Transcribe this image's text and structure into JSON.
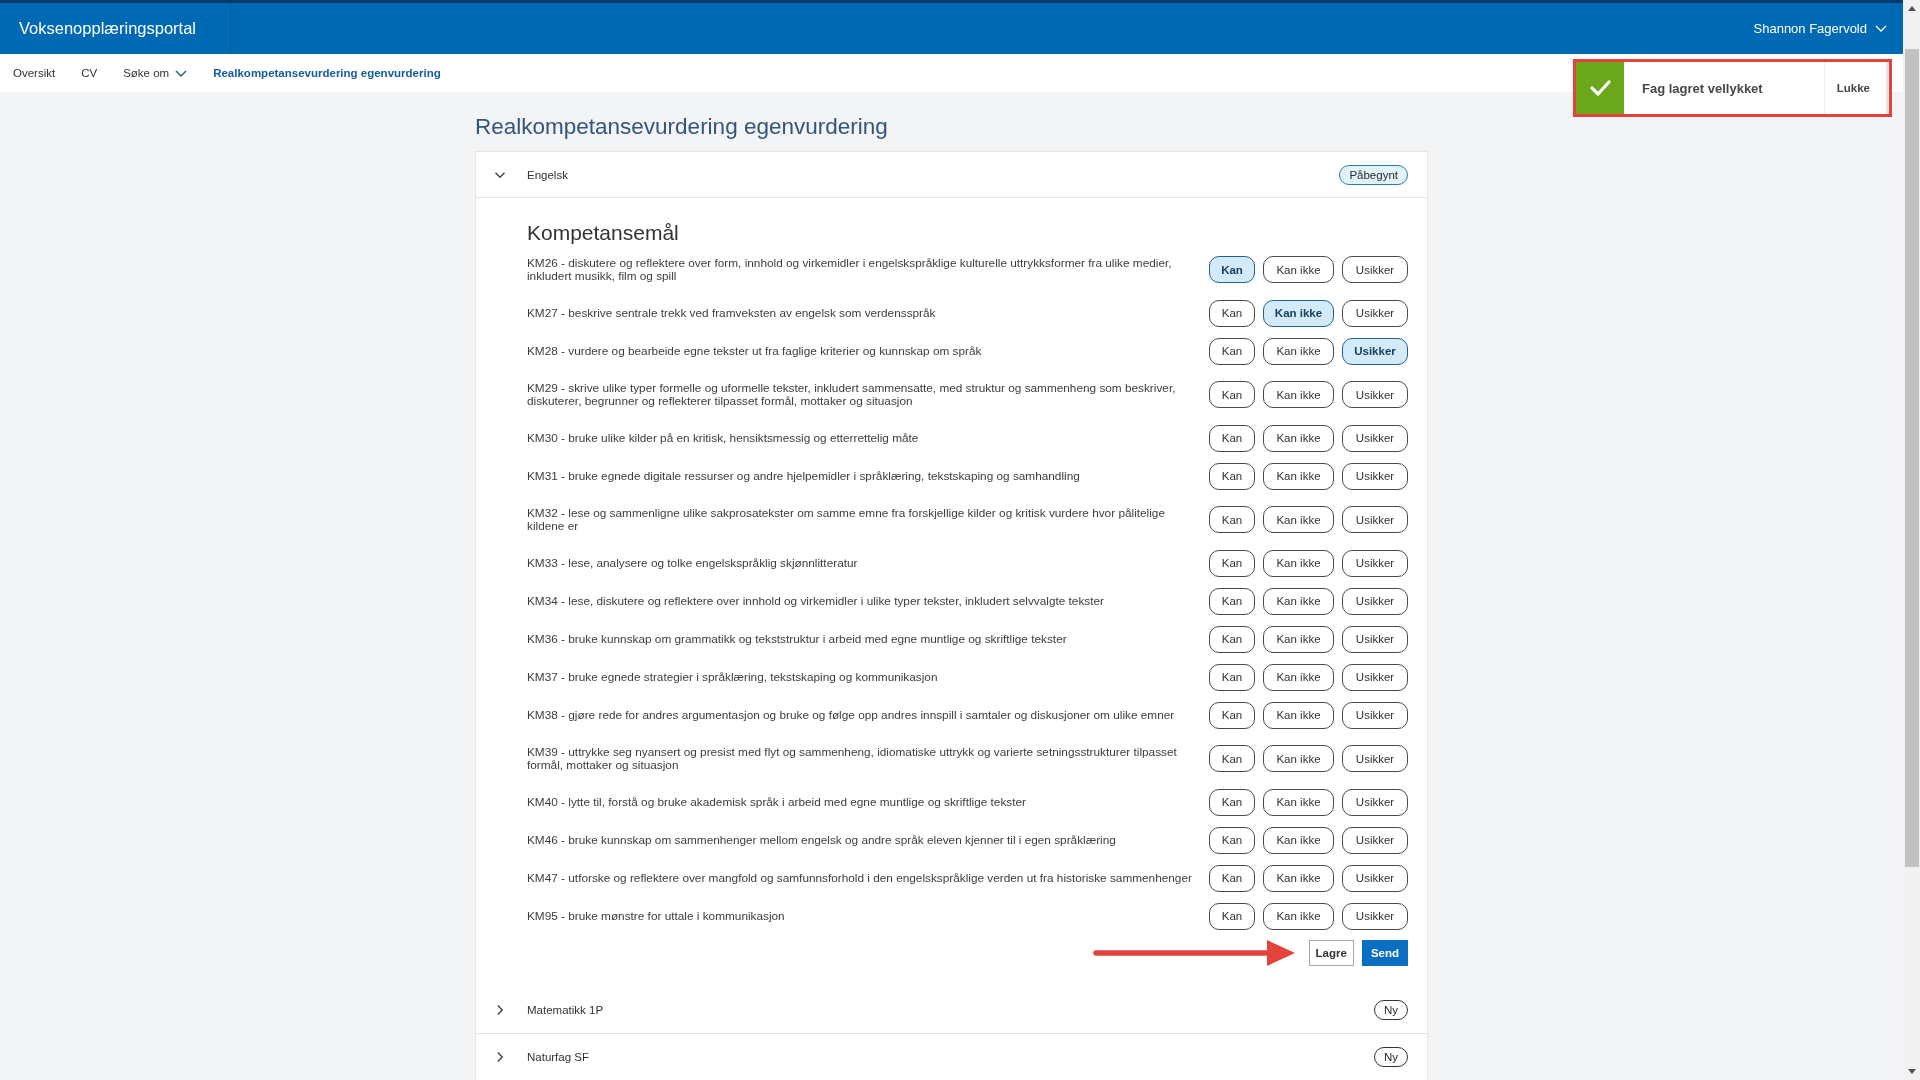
{
  "header": {
    "brand": "Voksenopplæringsportal",
    "user": "Shannon Fagervold"
  },
  "nav": {
    "items": [
      {
        "label": "Oversikt",
        "selected": false,
        "dropdown": false
      },
      {
        "label": "CV",
        "selected": false,
        "dropdown": false
      },
      {
        "label": "Søke om",
        "selected": false,
        "dropdown": true
      },
      {
        "label": "Realkompetansevurdering egenvurdering",
        "selected": true,
        "dropdown": false
      }
    ]
  },
  "toast": {
    "kind": "success",
    "message": "Fag lagret vellykket",
    "close": "Lukke",
    "highlighted": true
  },
  "page": {
    "title": "Realkompetansevurdering egenvurdering"
  },
  "subjects": [
    {
      "name": "Engelsk",
      "expanded": true,
      "status": {
        "label": "Påbegynt",
        "kind": "progress"
      },
      "section_title": "Kompetansemål",
      "goals": [
        {
          "text": "KM26 - diskutere og reflektere over form, innhold og virkemidler i engelskspråklige kulturelle uttrykksformer fra ulike medier, inkludert musikk, film og spill",
          "options": [
            {
              "label": "Kan",
              "selected": true
            },
            {
              "label": "Kan ikke",
              "selected": false
            },
            {
              "label": "Usikker",
              "selected": false
            }
          ]
        },
        {
          "text": "KM27 - beskrive sentrale trekk ved framveksten av engelsk som verdensspråk",
          "options": [
            {
              "label": "Kan",
              "selected": false
            },
            {
              "label": "Kan ikke",
              "selected": true
            },
            {
              "label": "Usikker",
              "selected": false
            }
          ]
        },
        {
          "text": "KM28 - vurdere og bearbeide egne tekster ut fra faglige kriterier og kunnskap om språk",
          "options": [
            {
              "label": "Kan",
              "selected": false
            },
            {
              "label": "Kan ikke",
              "selected": false
            },
            {
              "label": "Usikker",
              "selected": true
            }
          ]
        },
        {
          "text": "KM29 - skrive ulike typer formelle og uformelle tekster, inkludert sammensatte, med struktur og sammenheng som beskriver, diskuterer, begrunner og reflekterer tilpasset formål, mottaker og situasjon",
          "options": [
            {
              "label": "Kan",
              "selected": false
            },
            {
              "label": "Kan ikke",
              "selected": false
            },
            {
              "label": "Usikker",
              "selected": false
            }
          ]
        },
        {
          "text": "KM30 - bruke ulike kilder på en kritisk, hensiktsmessig og etterrettelig måte",
          "options": [
            {
              "label": "Kan",
              "selected": false
            },
            {
              "label": "Kan ikke",
              "selected": false
            },
            {
              "label": "Usikker",
              "selected": false
            }
          ]
        },
        {
          "text": "KM31 - bruke egnede digitale ressurser og andre hjelpemidler i språklæring, tekstskaping og samhandling",
          "options": [
            {
              "label": "Kan",
              "selected": false
            },
            {
              "label": "Kan ikke",
              "selected": false
            },
            {
              "label": "Usikker",
              "selected": false
            }
          ]
        },
        {
          "text": "KM32 - lese og sammenligne ulike sakprosatekster om samme emne fra forskjellige kilder og kritisk vurdere hvor pålitelige kildene er",
          "options": [
            {
              "label": "Kan",
              "selected": false
            },
            {
              "label": "Kan ikke",
              "selected": false
            },
            {
              "label": "Usikker",
              "selected": false
            }
          ]
        },
        {
          "text": "KM33 - lese, analysere og tolke engelskspråklig skjønnlitteratur",
          "options": [
            {
              "label": "Kan",
              "selected": false
            },
            {
              "label": "Kan ikke",
              "selected": false
            },
            {
              "label": "Usikker",
              "selected": false
            }
          ]
        },
        {
          "text": "KM34 - lese, diskutere og reflektere over innhold og virkemidler i ulike typer tekster, inkludert selvvalgte tekster",
          "options": [
            {
              "label": "Kan",
              "selected": false
            },
            {
              "label": "Kan ikke",
              "selected": false
            },
            {
              "label": "Usikker",
              "selected": false
            }
          ]
        },
        {
          "text": "KM36 - bruke kunnskap om grammatikk og tekststruktur i arbeid med egne muntlige og skriftlige tekster",
          "options": [
            {
              "label": "Kan",
              "selected": false
            },
            {
              "label": "Kan ikke",
              "selected": false
            },
            {
              "label": "Usikker",
              "selected": false
            }
          ]
        },
        {
          "text": "KM37 - bruke egnede strategier i språklæring, tekstskaping og kommunikasjon",
          "options": [
            {
              "label": "Kan",
              "selected": false
            },
            {
              "label": "Kan ikke",
              "selected": false
            },
            {
              "label": "Usikker",
              "selected": false
            }
          ]
        },
        {
          "text": "KM38 - gjøre rede for andres argumentasjon og bruke og følge opp andres innspill i samtaler og diskusjoner om ulike emner",
          "options": [
            {
              "label": "Kan",
              "selected": false
            },
            {
              "label": "Kan ikke",
              "selected": false
            },
            {
              "label": "Usikker",
              "selected": false
            }
          ]
        },
        {
          "text": "KM39 - uttrykke seg nyansert og presist med flyt og sammenheng, idiomatiske uttrykk og varierte setningsstrukturer tilpasset formål, mottaker og situasjon",
          "options": [
            {
              "label": "Kan",
              "selected": false
            },
            {
              "label": "Kan ikke",
              "selected": false
            },
            {
              "label": "Usikker",
              "selected": false
            }
          ]
        },
        {
          "text": "KM40 - lytte til, forstå og bruke akademisk språk i arbeid med egne muntlige og skriftlige tekster",
          "options": [
            {
              "label": "Kan",
              "selected": false
            },
            {
              "label": "Kan ikke",
              "selected": false
            },
            {
              "label": "Usikker",
              "selected": false
            }
          ]
        },
        {
          "text": "KM46 - bruke kunnskap om sammenhenger mellom engelsk og andre språk eleven kjenner til i egen språklæring",
          "options": [
            {
              "label": "Kan",
              "selected": false
            },
            {
              "label": "Kan ikke",
              "selected": false
            },
            {
              "label": "Usikker",
              "selected": false
            }
          ]
        },
        {
          "text": "KM47 - utforske og reflektere over mangfold og samfunnsforhold i den engelskspråklige verden ut fra historiske sammenhenger",
          "options": [
            {
              "label": "Kan",
              "selected": false
            },
            {
              "label": "Kan ikke",
              "selected": false
            },
            {
              "label": "Usikker",
              "selected": false
            }
          ]
        },
        {
          "text": "KM95 - bruke mønstre for uttale i kommunikasjon",
          "options": [
            {
              "label": "Kan",
              "selected": false
            },
            {
              "label": "Kan ikke",
              "selected": false
            },
            {
              "label": "Usikker",
              "selected": false
            }
          ]
        }
      ],
      "actions": [
        {
          "label": "Lagre",
          "kind": "secondary",
          "arrow": true
        },
        {
          "label": "Send",
          "kind": "primary",
          "arrow": false
        }
      ]
    },
    {
      "name": "Matematikk 1P",
      "expanded": false,
      "status": {
        "label": "Ny",
        "kind": "new"
      }
    },
    {
      "name": "Naturfag SF",
      "expanded": false,
      "status": {
        "label": "Ny",
        "kind": "new"
      }
    }
  ]
}
